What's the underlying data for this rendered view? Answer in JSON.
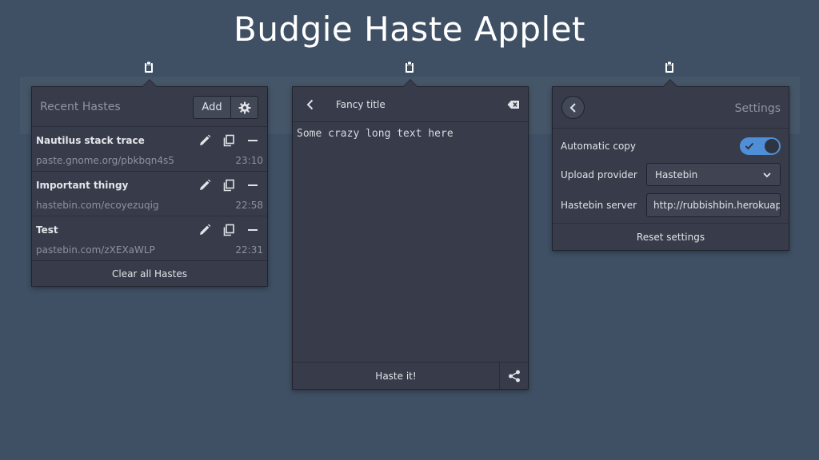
{
  "page": {
    "title": "Budgie Haste Applet"
  },
  "recent": {
    "title": "Recent Hastes",
    "add_label": "Add",
    "items": [
      {
        "title": "Nautilus stack trace",
        "url": "paste.gnome.org/pbkbqn4s5",
        "time": "23:10"
      },
      {
        "title": "Important thingy",
        "url": "hastebin.com/ecoyezuqig",
        "time": "22:58"
      },
      {
        "title": "Test",
        "url": "pastebin.com/zXEXaWLP",
        "time": "22:31"
      }
    ],
    "clear_label": "Clear all Hastes"
  },
  "editor": {
    "title": "Fancy title",
    "text": "Some crazy long text here",
    "haste_label": "Haste it!"
  },
  "settings": {
    "title": "Settings",
    "auto_copy_label": "Automatic copy",
    "auto_copy_value": true,
    "provider_label": "Upload provider",
    "provider_value": "Hastebin",
    "server_label": "Hastebin server",
    "server_value": "http://rubbishbin.herokuapp.com",
    "reset_label": "Reset settings"
  },
  "icons": {
    "tray": "clipboard-icon",
    "edit": "pencil-icon",
    "copy": "copy-icon",
    "delete": "minus-icon",
    "settings": "gear-icon",
    "back": "chevron-left-icon",
    "clear": "backspace-icon",
    "share": "share-icon",
    "dropdown": "chevron-down-icon",
    "toggle_check": "check-icon"
  },
  "colors": {
    "background": "#3f5064",
    "popover": "#383c4a",
    "accent": "#4f8fd8"
  }
}
